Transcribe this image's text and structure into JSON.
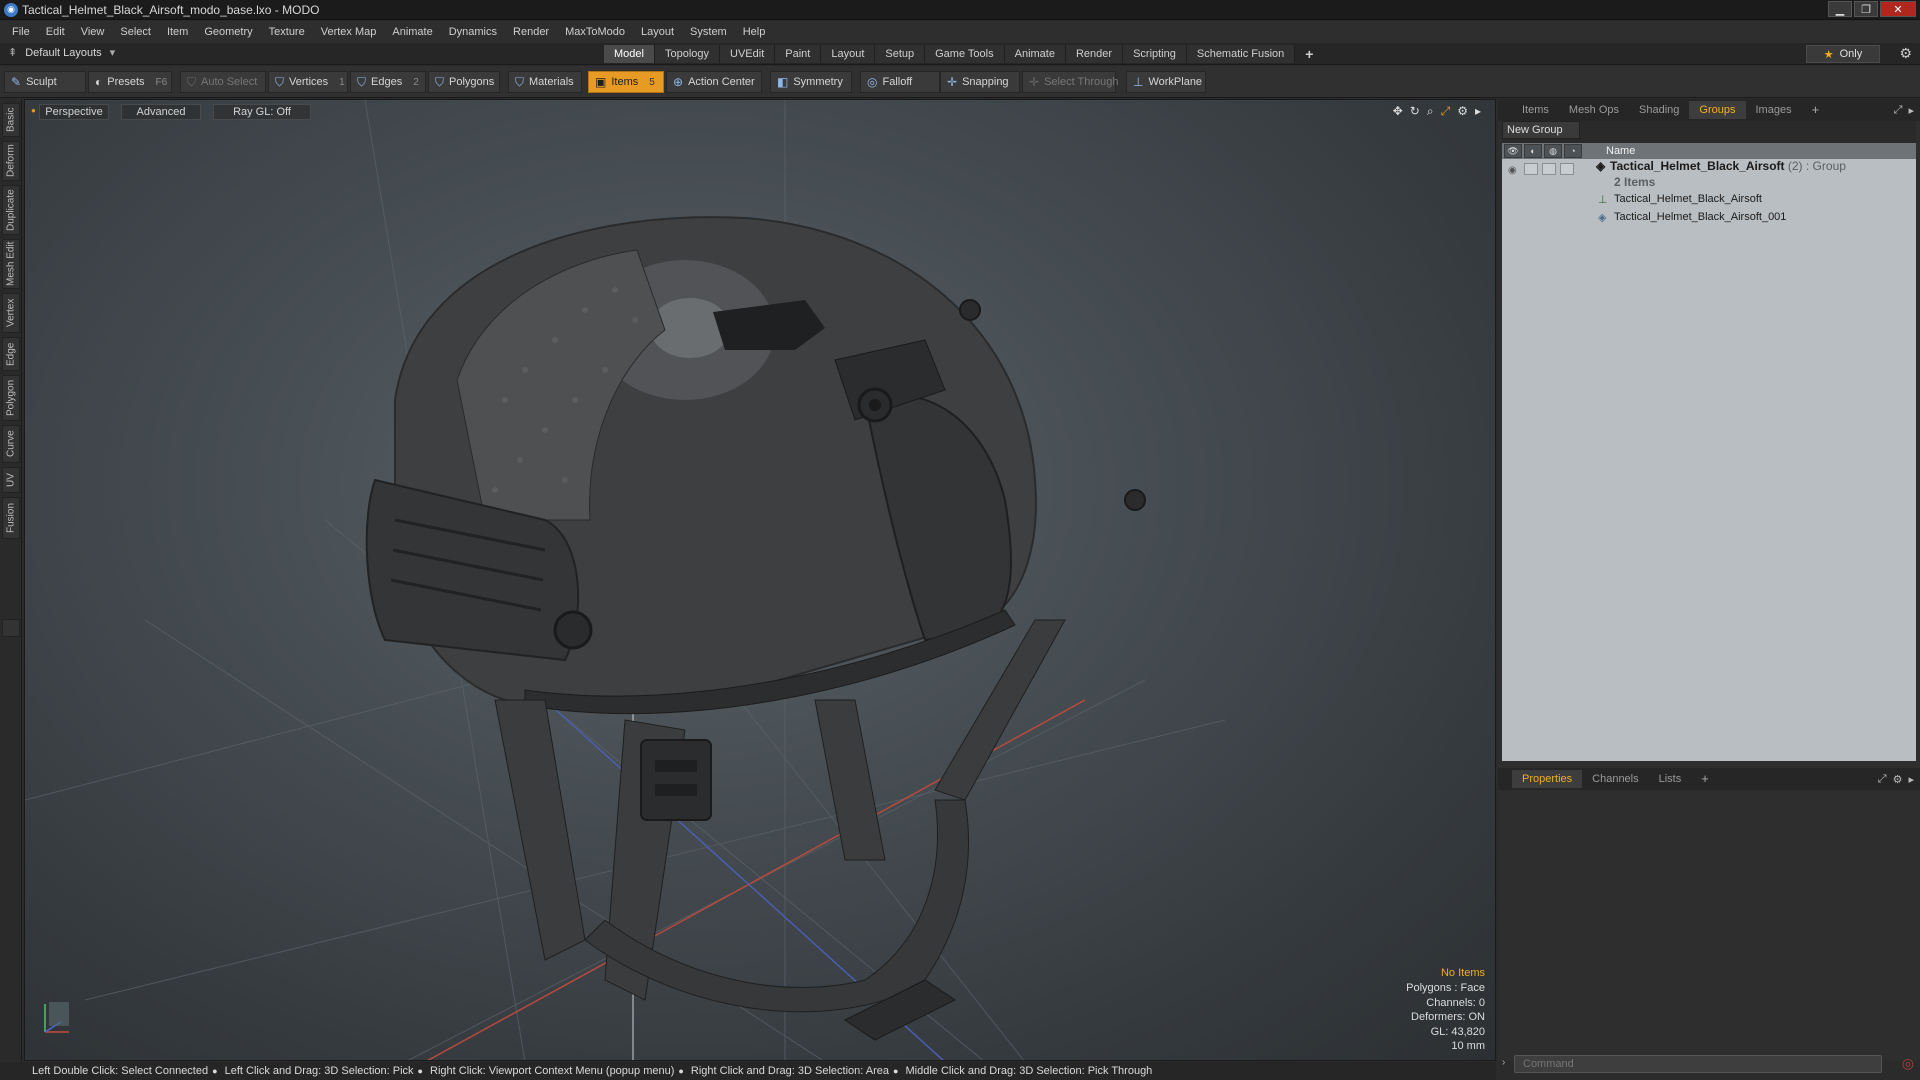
{
  "window": {
    "title": "Tactical_Helmet_Black_Airsoft_modo_base.lxo - MODO",
    "app_icon": "modo-icon",
    "buttons": [
      "minimize",
      "maximize",
      "close"
    ]
  },
  "menu": [
    "File",
    "Edit",
    "View",
    "Select",
    "Item",
    "Geometry",
    "Texture",
    "Vertex Map",
    "Animate",
    "Dynamics",
    "Render",
    "MaxToModo",
    "Layout",
    "System",
    "Help"
  ],
  "layouts": {
    "label": "Default Layouts"
  },
  "layout_tabs": [
    "Model",
    "Topology",
    "UVEdit",
    "Paint",
    "Layout",
    "Setup",
    "Game Tools",
    "Animate",
    "Render",
    "Scripting",
    "Schematic Fusion"
  ],
  "layout_tabs_active": "Model",
  "only_button": "Only",
  "toolbar": {
    "sculpt": "Sculpt",
    "presets": "Presets",
    "presets_key": "F6",
    "auto_select": "Auto Select",
    "vertices": "Vertices",
    "vertices_key": "1",
    "edges": "Edges",
    "edges_key": "2",
    "polygons": "Polygons",
    "materials": "Materials",
    "items": "Items",
    "items_key": "5",
    "action_center": "Action Center",
    "symmetry": "Symmetry",
    "falloff": "Falloff",
    "snapping": "Snapping",
    "select_through": "Select Through",
    "workplane": "WorkPlane"
  },
  "left_tabs": [
    "Basic",
    "Deform",
    "Duplicate",
    "Mesh Edit",
    "Vertex",
    "Edge",
    "Polygon",
    "Curve",
    "UV",
    "Fusion"
  ],
  "viewport": {
    "view": "Perspective",
    "mode": "Advanced",
    "raygl": "Ray GL: Off",
    "info": {
      "no_items": "No Items",
      "polygons": "Polygons : Face",
      "channels": "Channels: 0",
      "deformers": "Deformers: ON",
      "gl": "GL: 43,820",
      "scale": "10 mm"
    }
  },
  "right_panel": {
    "top_tabs": [
      "Items",
      "Mesh Ops",
      "Shading",
      "Groups",
      "Images"
    ],
    "top_tabs_active": "Groups",
    "new_group": "New Group",
    "column_name": "Name",
    "group": {
      "name": "Tactical_Helmet_Black_Airsoft",
      "count": "(2)",
      "type": ": Group",
      "sub": "2 Items"
    },
    "children": [
      "Tactical_Helmet_Black_Airsoft",
      "Tactical_Helmet_Black_Airsoft_001"
    ],
    "bottom_tabs": [
      "Properties",
      "Channels",
      "Lists"
    ],
    "bottom_tabs_active": "Properties",
    "command_placeholder": "Command"
  },
  "status_bar": [
    "Left Double Click: Select Connected",
    "Left Click and Drag: 3D Selection: Pick",
    "Right Click: Viewport Context Menu (popup menu)",
    "Right Click and Drag: 3D Selection: Area",
    "Middle Click and Drag: 3D Selection: Pick Through"
  ],
  "colors": {
    "accent": "#e79a24",
    "active_tab_text": "#f0b020",
    "viewport_bg": "#464d52"
  }
}
